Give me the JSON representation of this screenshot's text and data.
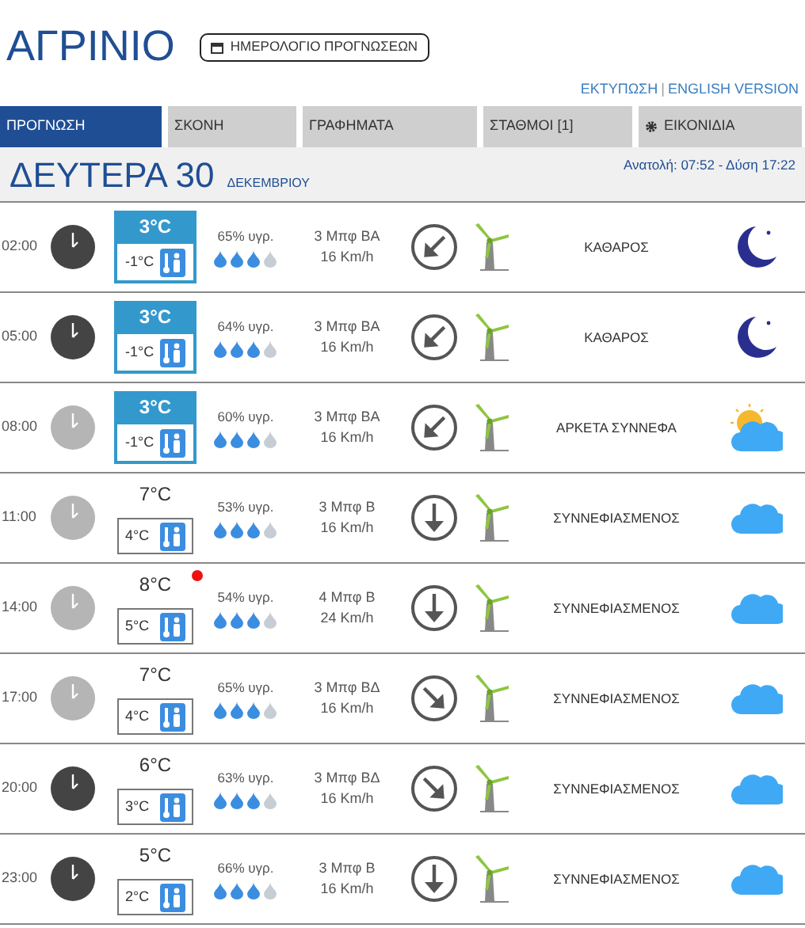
{
  "city": "ΑΓΡΙΝΙΟ",
  "calendar_button": "ΗΜΕΡΟΛΟΓΙΟ ΠΡΟΓΝΩΣΕΩΝ",
  "links": {
    "print": "ΕΚΤΥΠΩΣΗ",
    "separator": "|",
    "english": "ENGLISH VERSION"
  },
  "tabs": [
    {
      "label": "ΠΡΟΓΝΩΣΗ",
      "selected": true,
      "kind": "plain"
    },
    {
      "label": "ΣΚΟΝΗ",
      "selected": false,
      "kind": "plain"
    },
    {
      "label": "ΓΡΑΦΗΜΑΤΑ",
      "selected": false,
      "kind": "plain"
    },
    {
      "label": "ΣΤΑΘΜΟΙ [1]",
      "selected": false,
      "kind": "plain"
    },
    {
      "label": "ΕΙΚΟΝΙΔΙΑ",
      "selected": false,
      "kind": "gear"
    }
  ],
  "day": {
    "title": "ΔΕΥΤΕΡΑ 30",
    "month": "ΔΕΚΕΜΒΡΙΟΥ",
    "sun": "Ανατολή: 07:52 - Δύση 17:22"
  },
  "rows": [
    {
      "time": "02:00",
      "night": true,
      "temp": "3°C",
      "feels": "-1°C",
      "cold": true,
      "alert": false,
      "humidity": "65% υγρ.",
      "level": 0.75,
      "wind": {
        "force": "3 Μπφ ΒΑ",
        "speed": "16 Km/h",
        "kind": "sw"
      },
      "sky": {
        "condition": "ΚΑΘΑΡΟΣ",
        "kind": "moon"
      }
    },
    {
      "time": "05:00",
      "night": true,
      "temp": "3°C",
      "feels": "-1°C",
      "cold": true,
      "alert": false,
      "humidity": "64% υγρ.",
      "level": 0.75,
      "wind": {
        "force": "3 Μπφ ΒΑ",
        "speed": "16 Km/h",
        "kind": "sw"
      },
      "sky": {
        "condition": "ΚΑΘΑΡΟΣ",
        "kind": "moon"
      }
    },
    {
      "time": "08:00",
      "night": false,
      "temp": "3°C",
      "feels": "-1°C",
      "cold": true,
      "alert": false,
      "humidity": "60% υγρ.",
      "level": 0.75,
      "wind": {
        "force": "3 Μπφ ΒΑ",
        "speed": "16 Km/h",
        "kind": "sw"
      },
      "sky": {
        "condition": "ΑΡΚΕΤΑ ΣΥΝΝΕΦΑ",
        "kind": "sun-cloud"
      }
    },
    {
      "time": "11:00",
      "night": false,
      "temp": "7°C",
      "feels": "4°C",
      "cold": false,
      "alert": false,
      "humidity": "53% υγρ.",
      "level": 0.75,
      "wind": {
        "force": "3 Μπφ Β",
        "speed": "16 Km/h",
        "kind": "s"
      },
      "sky": {
        "condition": "ΣΥΝΝΕΦΙΑΣΜΕΝΟΣ",
        "kind": "cloud"
      }
    },
    {
      "time": "14:00",
      "night": false,
      "temp": "8°C",
      "feels": "5°C",
      "cold": false,
      "alert": true,
      "humidity": "54% υγρ.",
      "level": 0.75,
      "wind": {
        "force": "4 Μπφ Β",
        "speed": "24 Km/h",
        "kind": "s"
      },
      "sky": {
        "condition": "ΣΥΝΝΕΦΙΑΣΜΕΝΟΣ",
        "kind": "cloud"
      }
    },
    {
      "time": "17:00",
      "night": false,
      "temp": "7°C",
      "feels": "4°C",
      "cold": false,
      "alert": false,
      "humidity": "65% υγρ.",
      "level": 0.75,
      "wind": {
        "force": "3 Μπφ ΒΔ",
        "speed": "16 Km/h",
        "kind": "se"
      },
      "sky": {
        "condition": "ΣΥΝΝΕΦΙΑΣΜΕΝΟΣ",
        "kind": "cloud"
      }
    },
    {
      "time": "20:00",
      "night": true,
      "temp": "6°C",
      "feels": "3°C",
      "cold": false,
      "alert": false,
      "humidity": "63% υγρ.",
      "level": 0.75,
      "wind": {
        "force": "3 Μπφ ΒΔ",
        "speed": "16 Km/h",
        "kind": "se"
      },
      "sky": {
        "condition": "ΣΥΝΝΕΦΙΑΣΜΕΝΟΣ",
        "kind": "cloud"
      }
    },
    {
      "time": "23:00",
      "night": true,
      "temp": "5°C",
      "feels": "2°C",
      "cold": false,
      "alert": false,
      "humidity": "66% υγρ.",
      "level": 0.75,
      "wind": {
        "force": "3 Μπφ Β",
        "speed": "16 Km/h",
        "kind": "s"
      },
      "sky": {
        "condition": "ΣΥΝΝΕΦΙΑΣΜΕΝΟΣ",
        "kind": "cloud"
      }
    }
  ]
}
